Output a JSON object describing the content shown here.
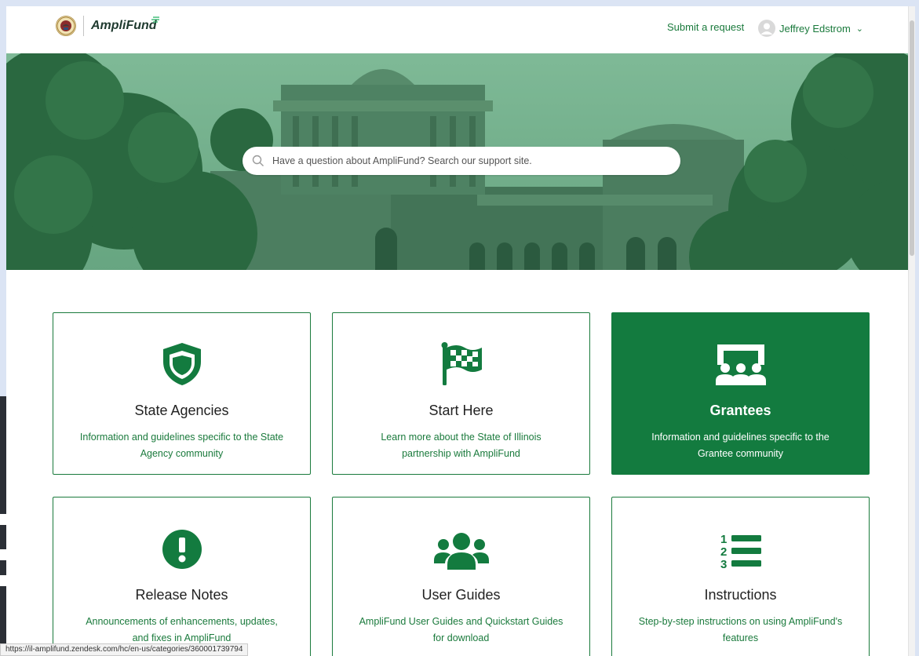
{
  "header": {
    "logo_text": "AmpliFund",
    "submit_request": "Submit a request",
    "user_name": "Jeffrey Edstrom"
  },
  "search": {
    "placeholder": "Have a question about AmpliFund? Search our support site."
  },
  "cards": [
    {
      "title": "State Agencies",
      "desc": "Information and guidelines specific to the State Agency community",
      "icon": "shield-icon"
    },
    {
      "title": "Start Here",
      "desc": "Learn more about the State of Illinois partnership with AmpliFund",
      "icon": "checkered-flag-icon"
    },
    {
      "title": "Grantees",
      "desc": "Information and guidelines specific to the Grantee community",
      "icon": "presentation-audience-icon"
    },
    {
      "title": "Release Notes",
      "desc": "Announcements of enhancements, updates, and fixes in AmpliFund",
      "icon": "exclamation-circle-icon"
    },
    {
      "title": "User Guides",
      "desc": "AmpliFund User Guides and Quickstart Guides for download",
      "icon": "users-group-icon"
    },
    {
      "title": "Instructions",
      "desc": "Step-by-step instructions on using AmpliFund's features",
      "icon": "numbered-list-icon"
    }
  ],
  "status_bar": {
    "url": "https://il-amplifund.zendesk.com/hc/en-us/categories/360001739794"
  },
  "colors": {
    "brand_green": "#137b3f",
    "link_green": "#1a7a3c",
    "hero_tint": "#2f8a55"
  }
}
